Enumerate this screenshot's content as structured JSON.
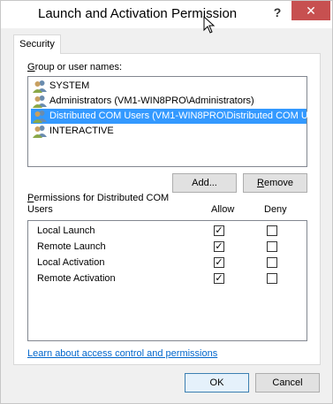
{
  "window": {
    "title": "Launch and Activation Permission",
    "help_glyph": "?",
    "close_glyph": "✕"
  },
  "tabs": [
    {
      "label": "Security"
    }
  ],
  "group_label": "Group or user names:",
  "users": [
    {
      "name": "SYSTEM",
      "icon": "users-icon",
      "selected": false
    },
    {
      "name": "Administrators (VM1-WIN8PRO\\Administrators)",
      "icon": "users-icon",
      "selected": false
    },
    {
      "name": "Distributed COM Users (VM1-WIN8PRO\\Distributed COM U...",
      "icon": "users-icon",
      "selected": true
    },
    {
      "name": "INTERACTIVE",
      "icon": "users-icon",
      "selected": false
    }
  ],
  "buttons": {
    "add": "Add...",
    "remove": "Remove",
    "ok": "OK",
    "cancel": "Cancel"
  },
  "permissions": {
    "header_line1": "Permissions for Distributed COM",
    "header_line2": "Users",
    "allow_label": "Allow",
    "deny_label": "Deny",
    "rows": [
      {
        "name": "Local Launch",
        "allow": true,
        "deny": false
      },
      {
        "name": "Remote Launch",
        "allow": true,
        "deny": false
      },
      {
        "name": "Local Activation",
        "allow": true,
        "deny": false
      },
      {
        "name": "Remote Activation",
        "allow": true,
        "deny": false
      }
    ]
  },
  "link_text": "Learn about access control and permissions",
  "colors": {
    "selection": "#3399ff",
    "close_button": "#c75050",
    "link": "#0066cc"
  }
}
